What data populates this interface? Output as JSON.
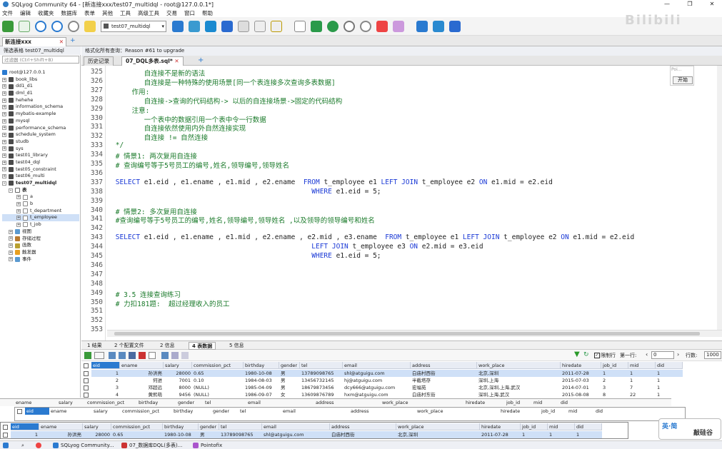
{
  "window": {
    "title": "SQLyog Community 64 - [新连接xxx/test07_multidql - root@127.0.0.1*]"
  },
  "menu": [
    "文件",
    "编辑",
    "收藏夹",
    "数据库",
    "表单",
    "其他",
    "工具",
    "高级工具",
    "交易",
    "窗口",
    "帮助"
  ],
  "toolbar": {
    "db_select": "test07_multidql"
  },
  "watermark": "Bilibili",
  "connection_tab": "新连接xxx",
  "sidebar": {
    "title": "筛选表格 test07_multidql",
    "filter_placeholder": "过滤器 (Ctrl+Shift+B)",
    "root": "root@127.0.0.1",
    "databases": [
      "book_libs",
      "dd1_d1",
      "dml_d1",
      "hehehe",
      "information_schema",
      "mybatis-example",
      "mysql",
      "performance_schema",
      "schedule_system",
      "studb",
      "sys",
      "test01_library",
      "test04_dql",
      "test05_constraint",
      "test06_multi"
    ],
    "open_db": "test07_multidql",
    "tables_label": "表",
    "tables": [
      "a",
      "b",
      "t_department",
      "t_employee",
      "t_job"
    ],
    "folders": [
      "视图",
      "存储过程",
      "函数",
      "触发器",
      "事件"
    ]
  },
  "editor": {
    "info": "格式化所有查询：Reason #61 to upgrade",
    "tabs": [
      "历史记录",
      "07_DQL多表.sql*"
    ],
    "lines": [
      {
        "n": "325",
        "t": "        自连接不是新的语法",
        "k": "cmt"
      },
      {
        "n": "326",
        "t": "        自连接是一种特殊的使用场景[同一个表连接多次查询多表数据]",
        "k": "cmt"
      },
      {
        "n": "327",
        "t": "     作用:",
        "k": "cmt"
      },
      {
        "n": "328",
        "t": "        自连接->查询的代码结构-> 以后的自连接场景->固定的代码结构",
        "k": "cmt"
      },
      {
        "n": "329",
        "t": "     注意:",
        "k": "cmt"
      },
      {
        "n": "330",
        "t": "        一个表中的数据引用一个表中令一行数据",
        "k": "cmt"
      },
      {
        "n": "331",
        "t": "        自连接依然使用内外自然连接实现",
        "k": "cmt"
      },
      {
        "n": "332",
        "t": "        自连接 != 自然连接",
        "k": "cmt"
      },
      {
        "n": "333",
        "t": " */",
        "k": "cmt"
      },
      {
        "n": "334",
        "t": " # 情景1: 两次复用自连接",
        "k": "cmt"
      },
      {
        "n": "335",
        "t": " # 查询编号等于5号员工的编号,姓名,领导编号,领导姓名",
        "k": "cmt"
      },
      {
        "n": "336",
        "t": "",
        "k": "tx"
      },
      {
        "n": "337",
        "t": " SELECT e1.eid , e1.ename , e1.mid , e2.ename  FROM t_employee e1 LEFT JOIN t_employee e2 ON e1.mid = e2.eid",
        "k": "sql"
      },
      {
        "n": "338",
        "t": "                                                 WHERE e1.eid = 5;",
        "k": "sql"
      },
      {
        "n": "339",
        "t": "",
        "k": "tx"
      },
      {
        "n": "340",
        "t": " # 情景2: 多次复用自连接",
        "k": "cmt"
      },
      {
        "n": "341",
        "t": " #查询编号等于5号员工的编号,姓名,领导编号,领导姓名 ,以及领导的领导编号和姓名",
        "k": "cmt"
      },
      {
        "n": "342",
        "t": "",
        "k": "tx"
      },
      {
        "n": "343",
        "t": " SELECT e1.eid , e1.ename , e1.mid , e2.ename , e2.mid , e3.ename  FROM t_employee e1 LEFT JOIN t_employee e2 ON e1.mid = e2.eid",
        "k": "sql"
      },
      {
        "n": "344",
        "t": "                                                 LEFT JOIN t_employee e3 ON e2.mid = e3.eid",
        "k": "sql"
      },
      {
        "n": "345",
        "t": "                                                 WHERE e1.eid = 5;",
        "k": "sql"
      },
      {
        "n": "346",
        "t": "",
        "k": "tx"
      },
      {
        "n": "347",
        "t": "",
        "k": "tx"
      },
      {
        "n": "348",
        "t": "",
        "k": "tx"
      },
      {
        "n": "349",
        "t": " # 3.5 连接查询练习",
        "k": "cmt"
      },
      {
        "n": "350",
        "t": " # 力扣181题:  超过经理收入的员工",
        "k": "cmt"
      },
      {
        "n": "351",
        "t": "",
        "k": "tx"
      },
      {
        "n": "352",
        "t": "",
        "k": "tx"
      },
      {
        "n": "353",
        "t": "",
        "k": "tx"
      }
    ]
  },
  "popup": {
    "title": "Poi...",
    "button": "开始"
  },
  "result_tabs": [
    "1 结果",
    "2 个配置文件",
    "2 信息",
    "4 表数据",
    "5 信息"
  ],
  "result_tools": {
    "limit_label": "限制行",
    "first_row_label": "第一行:",
    "first_row": "0",
    "rows_label": "行数:",
    "rows": "1000"
  },
  "grid": {
    "columns": [
      "eid",
      "ename",
      "salary",
      "commission_pct",
      "birthday",
      "gender",
      "tel",
      "email",
      "address",
      "work_place",
      "hiredate",
      "job_id",
      "mid",
      "did"
    ],
    "rows": [
      [
        "1",
        "孙洪亮",
        "28000",
        "0.65",
        "1980-10-08",
        "男",
        "13789098765",
        "shl@atguigu.com",
        "白庙村西街",
        "北京,深圳",
        "2011-07-28",
        "1",
        "1",
        "1"
      ],
      [
        "2",
        "何进",
        "7001",
        "0.10",
        "1984-08-03",
        "男",
        "13456732145",
        "hj@atguigu.com",
        "半截塔存",
        "深圳,上海",
        "2015-07-03",
        "2",
        "1",
        "1"
      ],
      [
        "3",
        "邓超远",
        "8000",
        "(NULL)",
        "1985-04-09",
        "男",
        "18679873456",
        "dcy666@atguigu.com",
        "宏福苑",
        "北京,深圳,上海,武汉",
        "2014-07-01",
        "3",
        "7",
        "1"
      ],
      [
        "4",
        "黄熙萌",
        "9456",
        "(NULL)",
        "1986-09-07",
        "女",
        "13609876789",
        "hxm@atguigu.com",
        "白庙村东街",
        "深圳,上海,武汉",
        "2015-08-08",
        "8",
        "22",
        "1"
      ]
    ]
  },
  "ghost": {
    "cols1": [
      "eid",
      "ename",
      "salary",
      "commission_pct",
      "birthday",
      "gender",
      "tel",
      "email",
      "address",
      "work_place",
      "hiredate",
      "job_id",
      "mid",
      "did"
    ],
    "row1": [
      "1",
      "孙洪亮",
      "28000",
      "0.65",
      "1980-10-08",
      "男",
      "13789098765",
      "shl@atguigu.com",
      "白庙村西街",
      "北京,深圳",
      "2011-07-28",
      "1",
      "1",
      "1"
    ]
  },
  "taskbar": [
    "SQLyog Community...",
    "07_数据库DQL(多表)...",
    "Pointofix"
  ],
  "widget": {
    "label": "英·简",
    "brand": "敲硅谷"
  }
}
